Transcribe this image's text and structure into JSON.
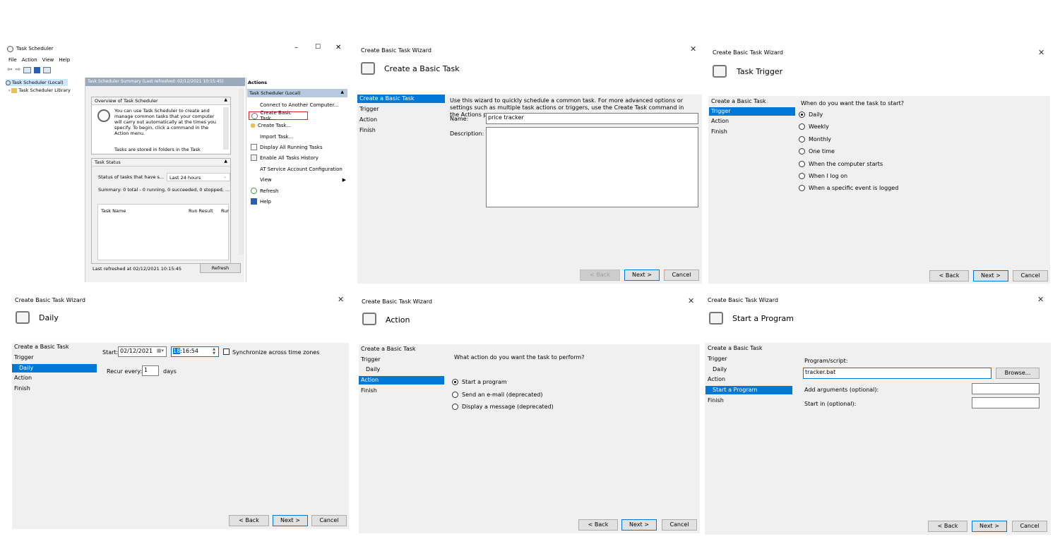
{
  "ts": {
    "title": "Task Scheduler",
    "menu": [
      "File",
      "Action",
      "View",
      "Help"
    ],
    "win_controls": [
      "–",
      "☐",
      "✕"
    ],
    "tree": [
      "Task Scheduler (Local)",
      "Task Scheduler Library"
    ],
    "summary_header": "Task Scheduler Summary (Last refreshed: 02/12/2021 10:15:45)",
    "overview_title": "Overview of Task Scheduler",
    "overview_text": "You can use Task Scheduler to create and manage common tasks that your computer will carry out automatically at the times you specify. To begin, click a command in the Action menu.",
    "overview_text2": "Tasks are stored in folders in the Task",
    "status_title": "Task Status",
    "status_label": "Status of tasks that have s...",
    "status_select": "Last 24 hours",
    "summary_line": "Summary: 0 total - 0 running, 0 succeeded, 0 stopped, ...",
    "col_task_name": "Task Name",
    "col_run_result": "Run Result",
    "col_run": "Rur",
    "last_refreshed": "Last refreshed at 02/12/2021 10:15:45",
    "refresh_btn": "Refresh",
    "actions_header": "Actions",
    "actions_group": "Task Scheduler (Local)",
    "actions": [
      "Connect to Another Computer...",
      "Create Basic Task...",
      "Create Task...",
      "Import Task...",
      "Display All Running Tasks",
      "Enable All Tasks History",
      "AT Service Account Configuration",
      "View",
      "Refresh",
      "Help"
    ]
  },
  "w1": {
    "window_title": "Create Basic Task Wizard",
    "header": "Create a Basic Task",
    "steps": [
      "Create a Basic Task",
      "Trigger",
      "Action",
      "Finish"
    ],
    "intro": "Use this wizard to quickly schedule a common task.  For more advanced options or settings such as multiple task actions or triggers, use the Create Task command in the Actions pane.",
    "name_label": "Name:",
    "name_value": "price tracker",
    "desc_label": "Description:",
    "back": "< Back",
    "next": "Next >",
    "cancel": "Cancel"
  },
  "w2": {
    "window_title": "Create Basic Task Wizard",
    "header": "Task Trigger",
    "steps": [
      "Create a Basic Task",
      "Trigger",
      "Action",
      "Finish"
    ],
    "question": "When do you want the task to start?",
    "options": [
      "Daily",
      "Weekly",
      "Monthly",
      "One time",
      "When the computer starts",
      "When I log on",
      "When a specific event is logged"
    ],
    "back": "< Back",
    "next": "Next >",
    "cancel": "Cancel"
  },
  "w3": {
    "window_title": "Create Basic Task Wizard",
    "header": "Daily",
    "steps": [
      "Create a Basic Task",
      "Trigger",
      "Daily",
      "Action",
      "Finish"
    ],
    "start_label": "Start:",
    "date_value": "02/12/2021",
    "time_hour": "18",
    "time_rest": ":16:54",
    "sync_label": "Synchronize across time zones",
    "recur_label": "Recur every:",
    "recur_value": "1",
    "recur_unit": "days",
    "back": "< Back",
    "next": "Next >",
    "cancel": "Cancel"
  },
  "w4": {
    "window_title": "Create Basic Task Wizard",
    "header": "Action",
    "steps": [
      "Create a Basic Task",
      "Trigger",
      "Daily",
      "Action",
      "Finish"
    ],
    "question": "What action do you want the task to perform?",
    "options": [
      "Start a program",
      "Send an e-mail (deprecated)",
      "Display a message (deprecated)"
    ],
    "back": "< Back",
    "next": "Next >",
    "cancel": "Cancel"
  },
  "w5": {
    "window_title": "Create Basic Task Wizard",
    "header": "Start a Program",
    "steps": [
      "Create a Basic Task",
      "Trigger",
      "Daily",
      "Action",
      "Start a Program",
      "Finish"
    ],
    "program_label": "Program/script:",
    "program_value": "tracker.bat",
    "browse": "Browse...",
    "args_label": "Add arguments (optional):",
    "startin_label": "Start in (optional):",
    "back": "< Back",
    "next": "Next >",
    "cancel": "Cancel"
  }
}
